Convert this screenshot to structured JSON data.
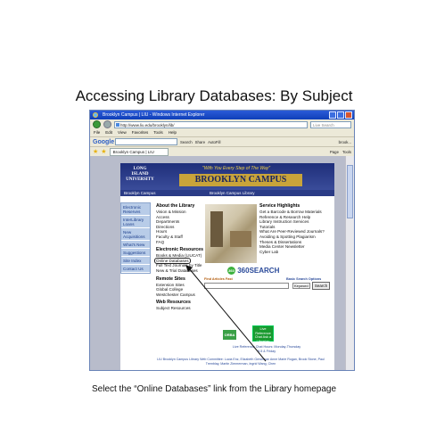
{
  "slide": {
    "title": "Accessing Library Databases: By Subject",
    "caption": "Select the “Online Databases” link from the Library homepage"
  },
  "browser": {
    "title": "Brooklyn Campus | LIU - Windows Internet Explorer",
    "address": "http://www.liu.edu/brooklyn/lib/",
    "search_placeholder": "Live Search",
    "menu": [
      "File",
      "Edit",
      "View",
      "Favorites",
      "Tools",
      "Help"
    ],
    "google_label": "Google",
    "google_tools": [
      "Search",
      "Share",
      "AutoFill",
      "brook..."
    ],
    "tab_label": "Brooklyn Campus | LIU",
    "tab_tools": [
      "Page",
      "Tools"
    ]
  },
  "site": {
    "logo": "LONG ISLAND UNIVERSITY",
    "tagline": "\"With You Every Step of The Way\"",
    "campus_name": "BROOKLYN CAMPUS",
    "nav_left": "Brooklyn Campus",
    "nav_center": "Brooklyn Campus Library",
    "sidebar": [
      "Electronic Reserves",
      "InterLibrary Loans",
      "New Acquisitions",
      "What's New",
      "Suggestions",
      "Site Index",
      "Contact Us"
    ],
    "about": {
      "heading": "About the Library",
      "items": [
        "Vision & Mission",
        "Access",
        "Departments",
        "Directions",
        "Hours",
        "Faculty & Staff",
        "FAQ"
      ]
    },
    "electronic": {
      "heading": "Electronic Resources",
      "items": [
        "Books & Media (LIUCAT)",
        "Online Databases",
        "Full Text Journals by Title",
        "New & Trial Databases"
      ]
    },
    "remote": {
      "heading": "Remote Sites",
      "items": [
        "Extension Sites",
        "Global College",
        "Westchester Campus"
      ]
    },
    "web": {
      "heading": "Web Resources",
      "items": [
        "Subject Resources"
      ]
    },
    "service": {
      "heading": "Service Highlights",
      "items": [
        "Get a Barcode & Borrow Materials",
        "Reference & Research Help",
        "Library Instruction Services",
        "Tutorials",
        "What Are Peer-Reviewed Journals?",
        "Avoiding & Spotting Plagiarism",
        "Theses & Dissertations",
        "Media Center Newsletter",
        "Cyber Lab"
      ]
    },
    "search360": "360SEARCH",
    "find_articles": "Find Articles Fast",
    "basic_search": "Basic Search Options",
    "keyword": "Keyword",
    "search_button": "Search",
    "orbs": "ORBA",
    "ask": "Live Reference Chat Ask a Librarian",
    "chat": "Live Reference Chat Hours: Monday-Thursday 9-5 & Friday",
    "footer": "LIU Brooklyn Campus Library Web Committee: Lucia Enz, Elizabeth Gershman Anne Marie Rogan, Brook Stone, Paul Tremblay, Martin Zimmerman, Ingrid Wang, Chen"
  }
}
